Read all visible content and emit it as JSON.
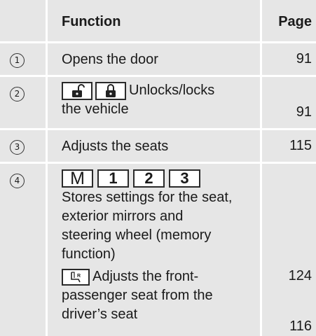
{
  "header": {
    "function": "Function",
    "page": "Page"
  },
  "rows": [
    {
      "num": "1",
      "function": "Opens the door",
      "page": "91"
    },
    {
      "num": "2",
      "keys": [
        "unlock-icon",
        "lock-icon"
      ],
      "function_a": "Unlocks/locks",
      "function_b": "the vehicle",
      "page": "91"
    },
    {
      "num": "3",
      "function": "Adjusts the seats",
      "page": "115"
    },
    {
      "num": "4",
      "keys": [
        "M",
        "1",
        "2",
        "3"
      ],
      "lines": [
        "Stores settings for the seat,",
        "exterior mirrors and",
        "steering wheel (memory",
        "function)"
      ],
      "page_a": "124",
      "seat_key": "passenger-seat-icon",
      "sub_lines": [
        "Adjusts the front-",
        "passenger seat from the",
        "driver’s seat"
      ],
      "page_b": "116"
    }
  ]
}
